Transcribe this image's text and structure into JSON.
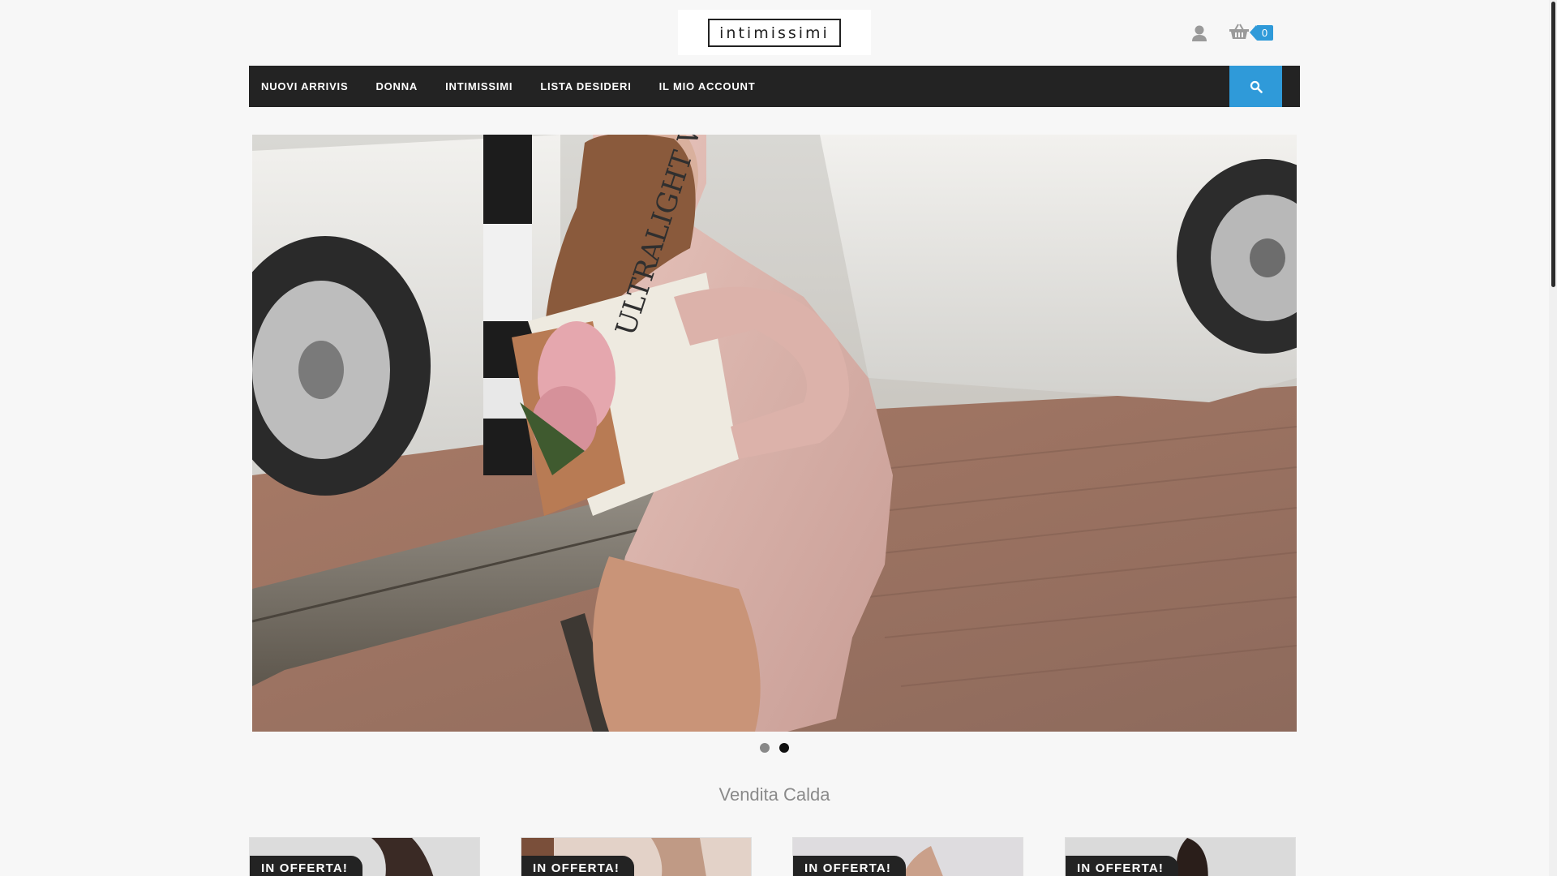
{
  "header": {
    "logo_text": "intimissimi",
    "cart_count": "0",
    "user_icon": "user-icon",
    "cart_icon": "basket-icon"
  },
  "nav": {
    "items": [
      {
        "label": "NUOVI ARRIVIS"
      },
      {
        "label": "DONNA"
      },
      {
        "label": "INTIMISSIMI"
      },
      {
        "label": "LISTA DESIDERI"
      },
      {
        "label": "IL MIO ACCOUNT"
      }
    ],
    "search_icon": "search-icon"
  },
  "slider": {
    "newspaper_text": "ULTRALIGHT WITH CASHMERE INTIMISSIMI",
    "slide_count": 2,
    "active_slide": 2
  },
  "section": {
    "title": "Vendita Calda"
  },
  "products": [
    {
      "badge": "IN OFFERTA!"
    },
    {
      "badge": "IN OFFERTA!"
    },
    {
      "badge": "IN OFFERTA!"
    },
    {
      "badge": "IN OFFERTA!"
    }
  ],
  "colors": {
    "accent": "#2f9ad9",
    "nav_bg": "#232323",
    "page_bg": "#f7f7f7"
  }
}
